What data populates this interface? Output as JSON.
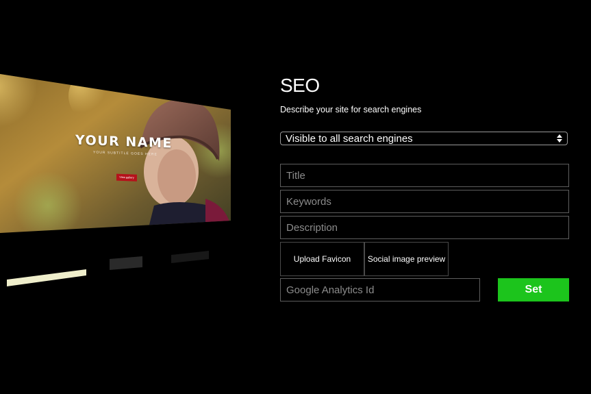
{
  "preview": {
    "name": "YOUR NAME",
    "tagline": "YOUR SUBTITLE GOES HERE",
    "button_label": "View gallery"
  },
  "seo": {
    "title": "SEO",
    "subtitle": "Describe your site for search engines",
    "visibility": {
      "selected": "Visible to all search engines"
    },
    "fields": {
      "title_placeholder": "Title",
      "keywords_placeholder": "Keywords",
      "description_placeholder": "Description",
      "ga_placeholder": "Google Analytics Id"
    },
    "buttons": {
      "upload_favicon": "Upload Favicon",
      "social_preview": "Social image preview",
      "set": "Set"
    }
  },
  "colors": {
    "background": "#000000",
    "accent_green": "#1cc41c",
    "preview_button_red": "#b5121b"
  }
}
